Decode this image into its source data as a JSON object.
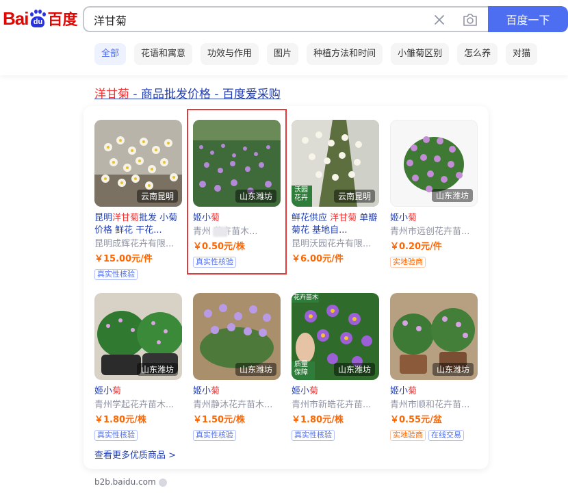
{
  "logo": {
    "text_bai": "Bai",
    "text_du": "du",
    "text_cn": "百度"
  },
  "search": {
    "query": "洋甘菊",
    "button_label": "百度一下"
  },
  "tabs": [
    {
      "label": "全部",
      "active": true
    },
    {
      "label": "花语和寓意"
    },
    {
      "label": "功效与作用"
    },
    {
      "label": "图片"
    },
    {
      "label": "种植方法和时间"
    },
    {
      "label": "小雏菊区别"
    },
    {
      "label": "怎么养"
    },
    {
      "label": "对猫"
    }
  ],
  "result": {
    "title_hl": "洋甘菊",
    "title_rest": " - 商品批发价格 - 百度爱采购",
    "more_link": "查看更多优质商品 >",
    "source": "b2b.baidu.com"
  },
  "products": [
    {
      "name_a": "昆明",
      "name_hl": "洋甘菊",
      "name_b": "批发 小菊价格 鲜花 干花...",
      "shop": "昆明成辉花卉有限...",
      "price": "￥15.00元/件",
      "location": "云南昆明",
      "badges": [
        {
          "text": "真实性核验",
          "style": "blue"
        }
      ]
    },
    {
      "name_a": "姬小",
      "name_hl": "菊",
      "name_b": "",
      "shop": "青州   花卉苗木...",
      "price": "￥0.50元/株",
      "location": "山东潍坊",
      "badges": [
        {
          "text": "真实性核验",
          "style": "blue"
        }
      ]
    },
    {
      "name_a": "鲜花供应 ",
      "name_hl": "洋甘菊",
      "name_b": " 单瓣菊花 基地自...",
      "shop": "昆明沃园花卉有限...",
      "price": "￥6.00元/件",
      "location": "云南昆明",
      "overlay_text": "沃园花卉",
      "badges": []
    },
    {
      "name_a": "姬小",
      "name_hl": "菊",
      "name_b": "",
      "shop": "青州市远创花卉苗...",
      "price": "￥0.20元/件",
      "location": "山东潍坊",
      "badges": [
        {
          "text": "实地验商",
          "style": "orange"
        }
      ]
    },
    {
      "name_a": "姬小",
      "name_hl": "菊",
      "name_b": "",
      "shop": "青州学起花卉苗木...",
      "price": "￥1.80元/株",
      "location": "山东潍坊",
      "badges": [
        {
          "text": "真实性核验",
          "style": "blue"
        }
      ]
    },
    {
      "name_a": "姬小",
      "name_hl": "菊",
      "name_b": "",
      "shop": "青州静沐花卉苗木...",
      "price": "￥1.50元/株",
      "location": "山东潍坊",
      "badges": [
        {
          "text": "真实性核验",
          "style": "blue"
        }
      ]
    },
    {
      "name_a": "姬小",
      "name_hl": "菊",
      "name_b": "",
      "shop": "青州市新皓花卉苗...",
      "price": "￥1.80元/株",
      "location": "山东潍坊",
      "overlay_text": "质量保障",
      "overlay_top": "花卉苗木",
      "badges": [
        {
          "text": "真实性核验",
          "style": "blue"
        }
      ]
    },
    {
      "name_a": "姬小",
      "name_hl": "菊",
      "name_b": "",
      "shop": "青州市顺和花卉苗...",
      "price": "￥0.55元/盆",
      "location": "山东潍坊",
      "badges": [
        {
          "text": "实地验商",
          "style": "orange"
        },
        {
          "text": "在线交易",
          "style": "blue"
        }
      ]
    }
  ],
  "colors": {
    "brand_red": "#e10601",
    "brand_blue": "#2932e1",
    "accent": "#4e6ef2",
    "price": "#ff6600",
    "link": "#2440b3",
    "highlight": "#f73131"
  }
}
